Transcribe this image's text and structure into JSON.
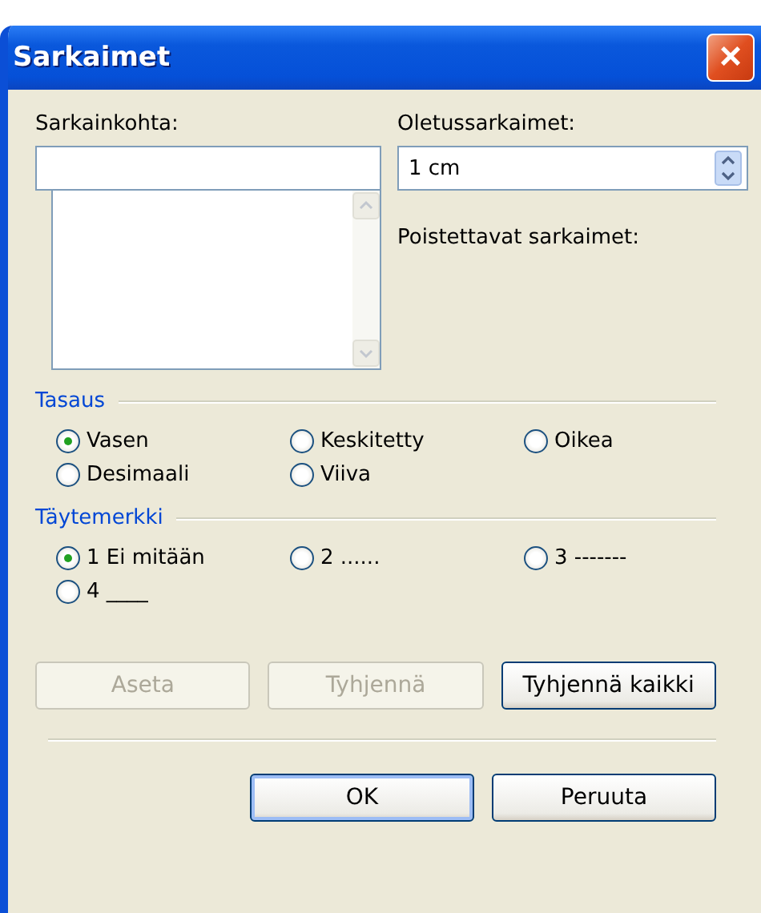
{
  "window": {
    "title": "Sarkaimet",
    "close": "×"
  },
  "tab_stop": {
    "label": "Sarkainkohta:"
  },
  "default_tabs": {
    "label": "Oletussarkaimet:",
    "value": "1 cm"
  },
  "tabs_to_clear": {
    "label": "Poistettavat sarkaimet:"
  },
  "alignment": {
    "title": "Tasaus",
    "options": [
      {
        "label": "Vasen",
        "selected": true
      },
      {
        "label": "Keskitetty",
        "selected": false
      },
      {
        "label": "Oikea",
        "selected": false
      },
      {
        "label": "Desimaali",
        "selected": false
      },
      {
        "label": "Viiva",
        "selected": false
      }
    ]
  },
  "leader": {
    "title": "Täytemerkki",
    "options": [
      {
        "label": "1 Ei mitään",
        "selected": true
      },
      {
        "label": "2 ......",
        "selected": false
      },
      {
        "label": "3 -------",
        "selected": false
      },
      {
        "label": "4 ____",
        "selected": false
      }
    ]
  },
  "actions": [
    {
      "label": "Aseta",
      "disabled": true
    },
    {
      "label": "Tyhjennä",
      "disabled": true
    },
    {
      "label": "Tyhjennä kaikki",
      "disabled": false
    }
  ],
  "buttons": [
    {
      "label": "OK",
      "default": true
    },
    {
      "label": "Peruuta",
      "default": false
    }
  ]
}
